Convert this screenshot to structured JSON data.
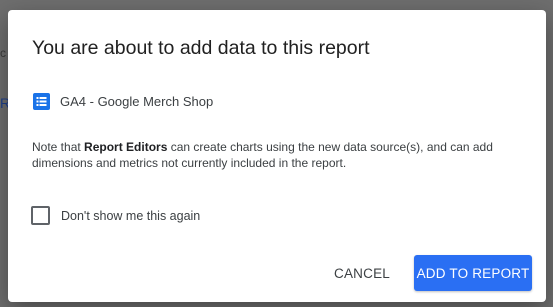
{
  "dialog": {
    "title": "You are about to add data to this report",
    "data_source": {
      "icon": "data-source-list-icon",
      "name": "GA4 - Google Merch Shop"
    },
    "note": {
      "prefix": "Note that ",
      "emphasis": "Report Editors",
      "suffix": " can create charts using the new data source(s), and can add dimensions and metrics not currently included in the report."
    },
    "dont_show_again": {
      "label": "Don't show me this again",
      "checked": false
    },
    "buttons": {
      "cancel": "CANCEL",
      "add": "ADD TO REPORT"
    }
  },
  "colors": {
    "primary": "#2a6ff3",
    "backdrop": "#6e6e6e",
    "text": "#3c4043"
  }
}
